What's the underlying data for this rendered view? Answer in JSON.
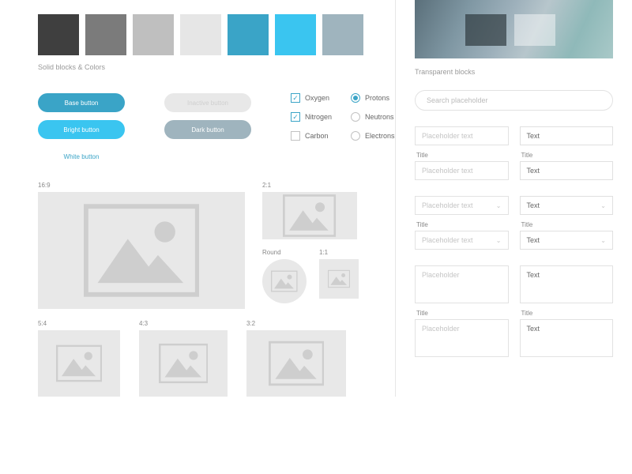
{
  "swatches": [
    "#3f3f3f",
    "#7b7b7b",
    "#bfbfbf",
    "#e6e6e6",
    "#3aa4c7",
    "#3ac5f0",
    "#9fb4be"
  ],
  "swatch_label": "Solid blocks & Colors",
  "transblock_label": "Transparent blocks",
  "buttons": {
    "base": "Base button",
    "inactive": "Inactive button",
    "bright": "Bright button",
    "dark": "Dark button",
    "white": "White button"
  },
  "checks": {
    "oxygen": "Oxygen",
    "nitrogen": "Nitrogen",
    "carbon": "Carbon"
  },
  "radios": {
    "protons": "Protons",
    "neutrons": "Neutrons",
    "electrons": "Electrons"
  },
  "ratios": {
    "r169": "16:9",
    "r21": "2:1",
    "round": "Round",
    "r11": "1:1",
    "r54": "5:4",
    "r43": "4:3",
    "r32": "3:2"
  },
  "search_placeholder": "Search placeholder",
  "inputs": {
    "placeholder": "Placeholder text",
    "value": "Text",
    "title": "Title",
    "ta_placeholder": "Placeholder"
  }
}
